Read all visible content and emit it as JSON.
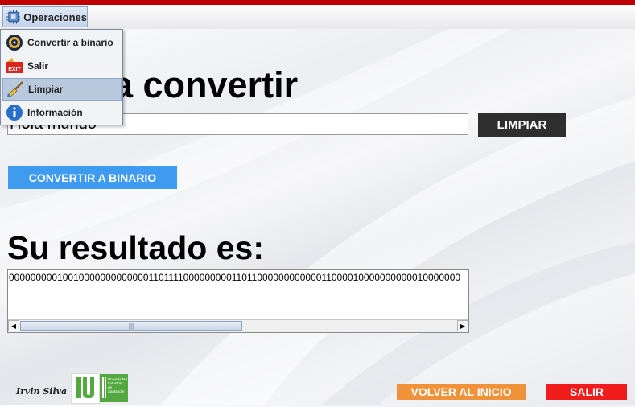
{
  "menubar": {
    "menu_label": "Operaciones",
    "menu_icon": "chip-icon",
    "items": [
      {
        "label": "Convertir a binario",
        "icon": "binary-disc-icon"
      },
      {
        "label": "Salir",
        "icon": "exit-sign-icon",
        "icon_text": "EXIT"
      },
      {
        "label": "Limpiar",
        "icon": "broom-icon"
      },
      {
        "label": "Información",
        "icon": "info-icon"
      }
    ],
    "active_item": "Limpiar"
  },
  "main": {
    "input_title_partial": "a convertir",
    "input_value": "Hola mundo",
    "limpiar_button": "LIMPIAR",
    "convertir_button": "CONVERTIR A BINARIO",
    "result_title": "Su resultado es:",
    "result_value": "0000000001001000000000000011011110000000001101100000000000011000010000000000010000000"
  },
  "footer": {
    "signature": "Irvin Silva",
    "uis_logo_text": "Universidad Industrial de Santander",
    "volver_button": "VOLVER AL INICIO",
    "salir_button": "SALIR"
  },
  "colors": {
    "top_accent": "#c00000",
    "limpiar_bg": "#2e2e2e",
    "convertir_bg": "#3e9bf0",
    "volver_bg": "#f0923a",
    "salir_bg": "#f01c1c",
    "uis_green": "#53a93f"
  }
}
